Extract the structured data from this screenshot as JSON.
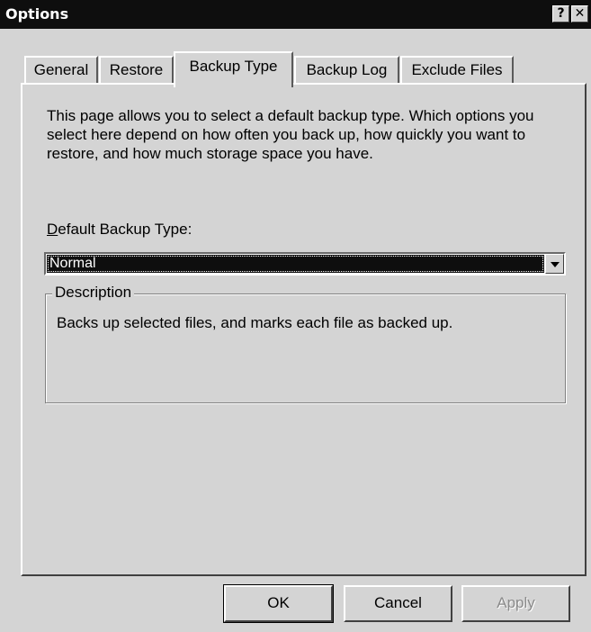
{
  "window": {
    "title": "Options",
    "help_label": "?",
    "close_label": "✕"
  },
  "tabs": [
    {
      "label": "General",
      "active": false
    },
    {
      "label": "Restore",
      "active": false
    },
    {
      "label": "Backup Type",
      "active": true
    },
    {
      "label": "Backup Log",
      "active": false
    },
    {
      "label": "Exclude Files",
      "active": false
    }
  ],
  "panel": {
    "intro_text": "This page allows you to select a default backup type. Which options you select here depend on how often you back up, how quickly you want to restore, and how much storage space you have.",
    "field_label_mnemonic": "D",
    "field_label_rest": "efault Backup Type:",
    "selected_type": "Normal",
    "description_legend": "Description",
    "description_text": "Backs up selected files, and marks each file as backed up."
  },
  "buttons": {
    "ok": "OK",
    "cancel": "Cancel",
    "apply": "Apply"
  }
}
